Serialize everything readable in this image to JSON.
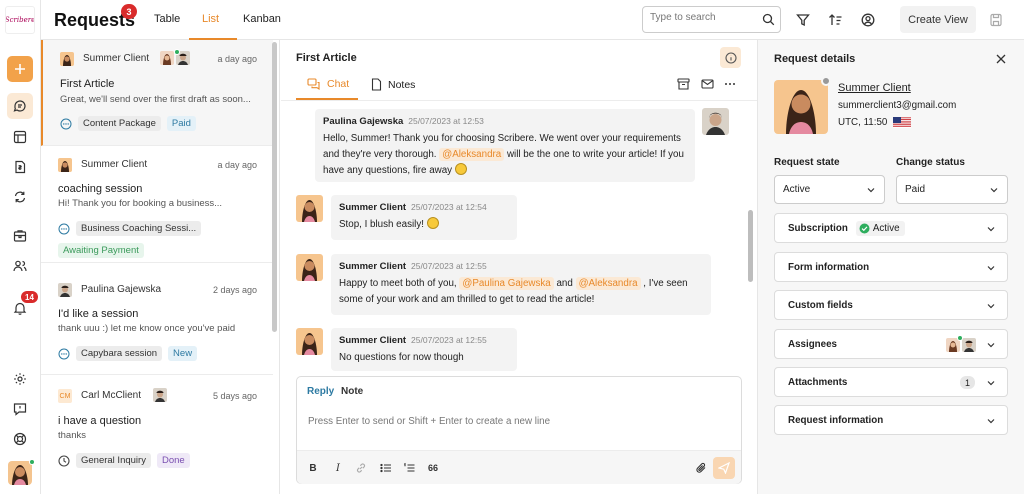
{
  "app": {
    "logo_text": "Scribere",
    "page_title": "Requests",
    "request_count": "3",
    "view_tabs": [
      "Table",
      "List",
      "Kanban"
    ],
    "active_tab": "List",
    "search_placeholder": "Type to search",
    "create_view_label": "Create View",
    "notification_count": "14",
    "accent_color": "#e8892a"
  },
  "requests": [
    {
      "client": "Summer Client",
      "when": "a day ago",
      "subject": "First Article",
      "preview": "Great, we'll send over the first draft as soon...",
      "service": "Content Package",
      "status": "Paid",
      "selected": true
    },
    {
      "client": "Summer Client",
      "when": "a day ago",
      "subject": "coaching session",
      "preview": "Hi! Thank you for booking a business...",
      "service": "Business Coaching Sessi...",
      "status": "Awaiting Payment"
    },
    {
      "client": "Paulina Gajewska",
      "when": "2 days ago",
      "subject": "I'd like a session",
      "preview": "thank uuu :) let me know once you've paid",
      "service": "Capybara session",
      "status": "New"
    },
    {
      "client": "Carl McClient",
      "client_initials": "CM",
      "when": "5 days ago",
      "subject": "i have a question",
      "preview": "thanks",
      "service": "General Inquiry",
      "status": "Done"
    }
  ],
  "chat": {
    "title": "First Article",
    "tabs": [
      "Chat",
      "Notes"
    ],
    "messages": [
      {
        "author": "Paulina Gajewska",
        "time": "25/07/2023 at 12:53",
        "line1": "Hello, Summer! Thank you for choosing Scribere. We went over your requirements",
        "line2_pre": "and they're very thorough.",
        "mention": "@Aleksandra",
        "line2_post": "will be the one to write your article! If you",
        "line3": "have any questions, fire away"
      },
      {
        "author": "Summer Client",
        "time": "25/07/2023 at 12:54",
        "text": "Stop, I blush easily!"
      },
      {
        "author": "Summer Client",
        "time": "25/07/2023 at 12:55",
        "pre": "Happy to meet both of you,",
        "mention1": "@Paulina Gajewska",
        "mid": "and",
        "mention2": "@Aleksandra",
        "post": ", I've seen",
        "line2": "some of your work and am thrilled to get to read the article!"
      },
      {
        "author": "Summer Client",
        "time": "25/07/2023 at 12:55",
        "text": "No questions for now though"
      }
    ],
    "composer": {
      "tabs": [
        "Reply",
        "Note"
      ],
      "placeholder": "Press Enter to send or Shift + Enter to create a new line",
      "quote_glyph": "66"
    }
  },
  "details": {
    "title": "Request details",
    "client_name": "Summer Client",
    "email": "summerclient3@gmail.com",
    "timezone": "UTC, 11:50",
    "request_state_label": "Request state",
    "request_state_value": "Active",
    "change_status_label": "Change status",
    "change_status_value": "Paid",
    "subscription_label": "Subscription",
    "subscription_value": "Active",
    "sections": [
      "Form information",
      "Custom fields",
      "Assignees",
      "Attachments",
      "Request information"
    ],
    "attachments_count": "1"
  }
}
